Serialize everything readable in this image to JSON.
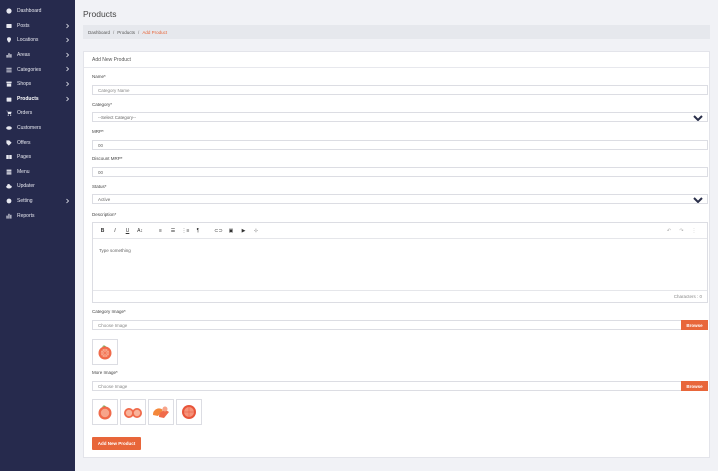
{
  "sidebar": {
    "items": [
      {
        "label": "Dashboard",
        "icon": "palette-icon",
        "has_submenu": false
      },
      {
        "label": "Posts",
        "icon": "card-icon",
        "has_submenu": true
      },
      {
        "label": "Locations",
        "icon": "map-pin-icon",
        "has_submenu": true
      },
      {
        "label": "Areas",
        "icon": "chart-icon",
        "has_submenu": true
      },
      {
        "label": "Categories",
        "icon": "list-icon",
        "has_submenu": true
      },
      {
        "label": "Shops",
        "icon": "store-icon",
        "has_submenu": true
      },
      {
        "label": "Products",
        "icon": "bag-icon",
        "has_submenu": true,
        "active": true
      },
      {
        "label": "Orders",
        "icon": "cart-icon",
        "has_submenu": false
      },
      {
        "label": "Customers",
        "icon": "eye-icon",
        "has_submenu": false
      },
      {
        "label": "Offers",
        "icon": "tag-icon",
        "has_submenu": false
      },
      {
        "label": "Pages",
        "icon": "book-icon",
        "has_submenu": false
      },
      {
        "label": "Menu",
        "icon": "menu-icon",
        "has_submenu": false
      },
      {
        "label": "Updater",
        "icon": "cloud-icon",
        "has_submenu": false
      },
      {
        "label": "Setting",
        "icon": "gear-icon",
        "has_submenu": true
      },
      {
        "label": "Reports",
        "icon": "bar-chart-icon",
        "has_submenu": false
      }
    ]
  },
  "header": {
    "title": "Products"
  },
  "breadcrumb": {
    "items": [
      "Dashboard",
      "Products",
      "Add Product"
    ],
    "separator": "/"
  },
  "form": {
    "card_title": "Add New Product",
    "name": {
      "label": "Name*",
      "placeholder": "Category Name"
    },
    "category": {
      "label": "Category*",
      "value": "--Select Category--"
    },
    "mrp": {
      "label": "MRP*",
      "value": "00"
    },
    "discount_mrp": {
      "label": "Discount MRP*",
      "value": "00"
    },
    "status": {
      "label": "Status*",
      "value": "Active"
    },
    "description": {
      "label": "Description*",
      "placeholder": "Type something",
      "characters": "Characters : 0"
    },
    "toolbar": {
      "buttons": [
        {
          "label": "B",
          "icon": "bold-icon"
        },
        {
          "label": "I",
          "icon": "italic-icon"
        },
        {
          "label": "U",
          "icon": "underline-icon"
        },
        {
          "label": "A↕",
          "icon": "font-size-icon"
        },
        {
          "label": "≡",
          "icon": "align-icon"
        },
        {
          "label": "☰",
          "icon": "unordered-list-icon"
        },
        {
          "label": "⋮≡",
          "icon": "ordered-list-icon"
        },
        {
          "label": "¶",
          "icon": "paragraph-icon"
        },
        {
          "label": "⊂⊃",
          "icon": "link-icon"
        },
        {
          "label": "▣",
          "icon": "image-icon"
        },
        {
          "label": "▶",
          "icon": "video-icon"
        },
        {
          "label": "⊹",
          "icon": "more-icon"
        }
      ],
      "right": [
        {
          "label": "↶",
          "icon": "undo-icon"
        },
        {
          "label": "↷",
          "icon": "redo-icon"
        },
        {
          "label": "⋮",
          "icon": "kebab-icon"
        }
      ]
    },
    "category_image": {
      "label": "Category Image*",
      "placeholder": "Choose Image",
      "browse_label": "Browse"
    },
    "more_image": {
      "label": "More Image*",
      "placeholder": "Choose Image",
      "browse_label": "Browse"
    },
    "submit_label": "Add New Product"
  },
  "colors": {
    "sidebar_bg": "#262a4d",
    "accent": "#e8663a"
  }
}
